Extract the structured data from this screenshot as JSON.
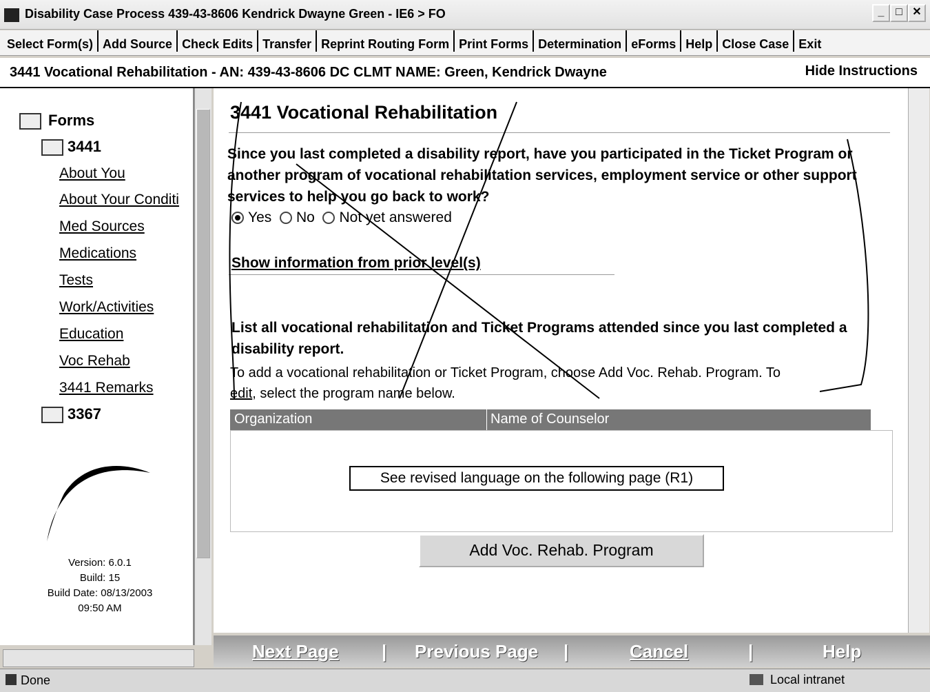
{
  "window": {
    "title": "Disability Case Process  439-43-8606  Kendrick Dwayne Green - IE6 > FO"
  },
  "menu": [
    "Select Form(s)",
    "Add Source",
    "Check Edits",
    "Transfer",
    "Reprint Routing Form",
    "Print Forms",
    "Determination",
    "eForms",
    "Help",
    "Close Case",
    "Exit"
  ],
  "form_header": {
    "title": "3441 Vocational Rehabilitation - AN: 439-43-8606 DC CLMT NAME: Green, Kendrick Dwayne",
    "hide_instructions": "Hide Instructions"
  },
  "sidebar": {
    "root": "Forms",
    "group1": "3441",
    "items": [
      "About You",
      "About Your Conditi",
      "Med Sources",
      "Medications",
      "Tests",
      "Work/Activities",
      "Education",
      "Voc Rehab",
      "3441 Remarks"
    ],
    "group2": "3367",
    "version": "Version: 6.0.1",
    "build": "Build: 15",
    "build_date": "Build Date: 08/13/2003",
    "build_time": "09:50 AM"
  },
  "main": {
    "page_title": "3441 Vocational Rehabilitation",
    "question": "Since you last completed a disability report, have you participated in the Ticket Program or another program of vocational rehabilitation services, employment service or other support services to help you go back to work?",
    "options": [
      "Yes",
      "No",
      "Not yet answered"
    ],
    "selected_option": "Yes",
    "prior_link": "Show information from prior level(s)",
    "list_heading": "List all vocational rehabilitation and Ticket Programs attended since you last completed a disability report.",
    "instruction_pre": "To add a vocational rehabilitation or Ticket Program, choose Add Voc. Rehab. Program. To",
    "instruction_edit": "edit",
    "instruction_post": ", select the program name below.",
    "columns": [
      "Organization",
      "Name of Counselor"
    ],
    "note": "See revised language on the following page (R1)",
    "add_button": "Add Voc. Rehab. Program"
  },
  "nav": {
    "next": "Next Page",
    "previous": "Previous Page",
    "cancel": "Cancel",
    "help": "Help",
    "sep": "|"
  },
  "status": {
    "text": "Done",
    "zone": "Local intranet"
  }
}
